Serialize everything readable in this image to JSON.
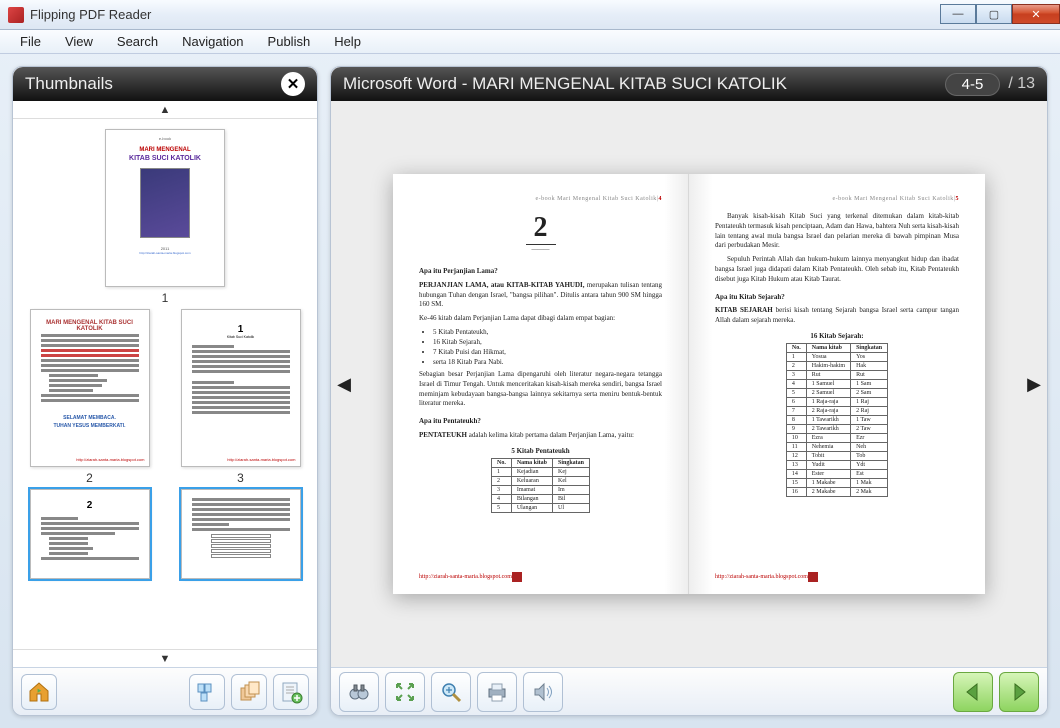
{
  "titlebar": {
    "title": "Flipping PDF Reader"
  },
  "menu": {
    "file": "File",
    "view": "View",
    "search": "Search",
    "navigation": "Navigation",
    "publish": "Publish",
    "help": "Help"
  },
  "thumbnails": {
    "heading": "Thumbnails",
    "labels": {
      "p1": "1",
      "p2": "2",
      "p3": "3"
    },
    "page1": {
      "line1": "MARI MENGENAL",
      "line2": "KITAB SUCI KATOLIK"
    },
    "page2": {
      "heading": "MARI MENGENAL KITAB SUCI KATOLIK",
      "closing1": "SELAMAT MEMBACA.",
      "closing2": "TUHAN YESUS MEMBERKATI."
    }
  },
  "viewer": {
    "doc_title": "Microsoft Word - MARI MENGENAL KITAB SUCI KATOLIK",
    "page_badge": "4-5",
    "page_total": "/ 13"
  },
  "book": {
    "left": {
      "header": "e-book Mari Mengenal Kitab Suci Katolik|",
      "page_no": "4",
      "chapter_num": "2",
      "chapter_caption": "———",
      "q1": "Apa itu Perjanjian Lama?",
      "para1a": "PERJANJIAN LAMA, atau KITAB-KITAB YAHUDI,",
      "para1b": " merupakan tulisan tentang hubungan Tuhan dengan Israel, \"bangsa pilihan\". Ditulis antara tahun 900 SM hingga 160 SM.",
      "para2": "Ke-46 kitab dalam Perjanjian Lama dapat dibagi dalam empat bagian:",
      "bullets": [
        "5 Kitab Pentateukh,",
        "16 Kitab Sejarah,",
        "7 Kitab Puisi dan Hikmat,",
        "serta 18 Kitab Para Nabi."
      ],
      "para3": "Sebagian besar Perjanjian Lama dipengaruhi oleh literatur negara-negara tetangga Israel di Timur Tengah. Untuk menceritakan kisah-kisah mereka sendiri, bangsa Israel meminjam kebudayaan bangsa-bangsa lainnya sekitarnya serta meniru bentuk-bentuk literatur mereka.",
      "q2": "Apa itu Pentateukh?",
      "para4a": "PENTATEUKH",
      "para4b": " adalah kelima kitab pertama dalam Perjanjian Lama, yaitu:",
      "table_title": "5 Kitab Pentateukh",
      "table_headers": [
        "No.",
        "Nama kitab",
        "Singkatan"
      ],
      "table_rows": [
        [
          "1",
          "Kejadian",
          "Kej"
        ],
        [
          "2",
          "Keluaran",
          "Kel"
        ],
        [
          "3",
          "Imamat",
          "Im"
        ],
        [
          "4",
          "Bilangan",
          "Bil"
        ],
        [
          "5",
          "Ulangan",
          "Ul"
        ]
      ],
      "footer_link": "http://ziarah-santa-maria.blogspot.com"
    },
    "right": {
      "header": "e-book Mari Mengenal Kitab Suci Katolik|",
      "page_no": "5",
      "para1": "Banyak kisah-kisah Kitab Suci yang terkenal ditemukan dalam kitab-kitab Pentateukh termasuk kisah penciptaan, Adam dan Hawa, bahtera Nuh serta kisah-kisah lain tentang awal mula bangsa Israel dan pelarian mereka di bawah pimpinan Musa dari perbudakan Mesir.",
      "para2": "Sepuluh Perintah Allah dan hukum-hukum lainnya menyangkut hidup dan ibadat bangsa Israel juga didapati dalam Kitab Pentateukh. Oleh sebab itu, Kitab Pentateukh disebut juga Kitab Hukum atau Kitab Taurat.",
      "q1": "Apa itu Kitab Sejarah?",
      "para3a": "KITAB SEJARAH",
      "para3b": " berisi kisah tentang Sejarah bangsa Israel serta campur tangan Allah dalam sejarah mereka.",
      "table_title": "16 Kitab Sejarah:",
      "table_headers": [
        "No.",
        "Nama kitab",
        "Singkatan"
      ],
      "table_rows": [
        [
          "1",
          "Yosua",
          "Yos"
        ],
        [
          "2",
          "Hakim-hakim",
          "Hak"
        ],
        [
          "3",
          "Rut",
          "Rut"
        ],
        [
          "4",
          "1 Samuel",
          "1 Sam"
        ],
        [
          "5",
          "2 Samuel",
          "2 Sam"
        ],
        [
          "6",
          "1 Raja-raja",
          "1 Raj"
        ],
        [
          "7",
          "2 Raja-raja",
          "2 Raj"
        ],
        [
          "8",
          "1 Tawarikh",
          "1 Taw"
        ],
        [
          "9",
          "2 Tawarikh",
          "2 Taw"
        ],
        [
          "10",
          "Ezra",
          "Ezr"
        ],
        [
          "11",
          "Nehemia",
          "Neh"
        ],
        [
          "12",
          "Tobit",
          "Tob"
        ],
        [
          "13",
          "Yudit",
          "Ydt"
        ],
        [
          "14",
          "Ester",
          "Est"
        ],
        [
          "15",
          "1 Makabe",
          "1 Mak"
        ],
        [
          "16",
          "2 Makabe",
          "2 Mak"
        ]
      ],
      "footer_link": "http://ziarah-santa-maria.blogspot.com"
    }
  }
}
